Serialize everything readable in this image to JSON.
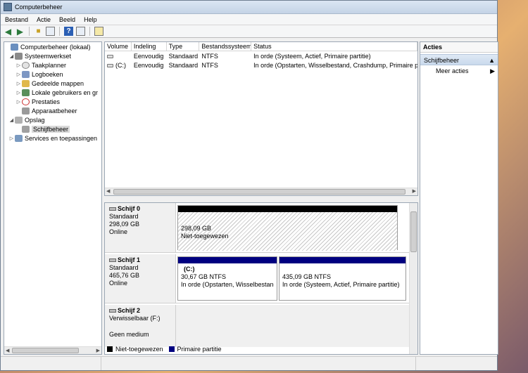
{
  "window": {
    "title": "Computerbeheer"
  },
  "menu": [
    "Bestand",
    "Actie",
    "Beeld",
    "Help"
  ],
  "tree": {
    "root": "Computerbeheer (lokaal)",
    "items": [
      {
        "label": "Systeemwerkset",
        "icon": "tools-icon"
      },
      {
        "label": "Taakplanner",
        "icon": "clock-icon"
      },
      {
        "label": "Logboeken",
        "icon": "event-log-icon"
      },
      {
        "label": "Gedeelde mappen",
        "icon": "shared-folder-icon"
      },
      {
        "label": "Lokale gebruikers en gr",
        "icon": "users-icon"
      },
      {
        "label": "Prestaties",
        "icon": "performance-icon"
      },
      {
        "label": "Apparaatbeheer",
        "icon": "device-manager-icon"
      },
      {
        "label": "Opslag",
        "icon": "storage-icon"
      },
      {
        "label": "Schijfbeheer",
        "icon": "disk-management-icon"
      },
      {
        "label": "Services en toepassingen",
        "icon": "services-icon"
      }
    ]
  },
  "volume_list": {
    "columns": [
      "Volume",
      "Indeling",
      "Type",
      "Bestandssysteem",
      "Status"
    ],
    "rows": [
      {
        "volume": "",
        "indeling": "Eenvoudig",
        "type": "Standaard",
        "fs": "NTFS",
        "status": "In orde (Systeem, Actief, Primaire partitie)"
      },
      {
        "volume": "(C:)",
        "indeling": "Eenvoudig",
        "type": "Standaard",
        "fs": "NTFS",
        "status": "In orde (Opstarten, Wisselbestand, Crashdump, Primaire pa"
      }
    ]
  },
  "disks": [
    {
      "name": "Schijf 0",
      "type": "Standaard",
      "size": "298,09 GB",
      "state": "Online",
      "partitions": [
        {
          "label": "",
          "line1": "298,09 GB",
          "line2": "Niet-toegewezen"
        }
      ]
    },
    {
      "name": "Schijf 1",
      "type": "Standaard",
      "size": "465,76 GB",
      "state": "Online",
      "partitions": [
        {
          "label": "(C:)",
          "line1": "30,67 GB NTFS",
          "line2": "In orde (Opstarten, Wisselbestand,"
        },
        {
          "label": "",
          "line1": "435,09 GB NTFS",
          "line2": "In orde (Systeem, Actief, Primaire partitie)"
        }
      ]
    },
    {
      "name": "Schijf 2",
      "type": "Verwisselbaar (F:)",
      "size": "",
      "state": "Geen medium",
      "partitions": []
    }
  ],
  "legend": [
    {
      "label": "Niet-toegewezen",
      "color": "#000000"
    },
    {
      "label": "Primaire partitie",
      "color": "#000080"
    }
  ],
  "actions": {
    "header": "Acties",
    "section": "Schijfbeheer",
    "items": [
      "Meer acties"
    ]
  }
}
